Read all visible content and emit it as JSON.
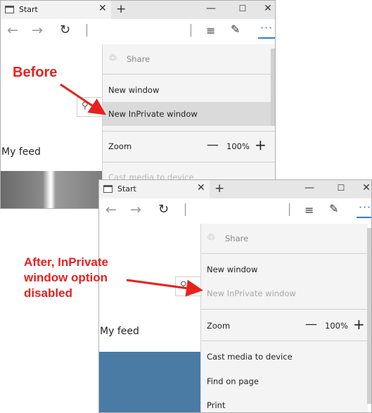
{
  "before_window": {
    "tab_title": "Start",
    "tab_close": "✕",
    "new_tab": "+",
    "minimize": "—",
    "maximize": "☐",
    "close": "✕",
    "page": {
      "feed_title": "My feed",
      "search_glyph": "⚲"
    },
    "menu": {
      "share": "Share",
      "new_window": "New window",
      "new_inprivate": "New InPrivate window",
      "zoom_label": "Zoom",
      "zoom_minus": "—",
      "zoom_value": "100%",
      "zoom_plus": "+",
      "cast": "Cast media to device"
    }
  },
  "after_window": {
    "tab_title": "Start",
    "tab_close": "✕",
    "new_tab": "+",
    "minimize": "—",
    "maximize": "☐",
    "close": "✕",
    "page": {
      "feed_title": "My feed",
      "search_glyph": "⚲"
    },
    "menu": {
      "share": "Share",
      "new_window": "New window",
      "new_inprivate": "New InPrivate window",
      "zoom_label": "Zoom",
      "zoom_minus": "—",
      "zoom_value": "100%",
      "zoom_plus": "+",
      "cast": "Cast media to device",
      "find": "Find on page",
      "print": "Print"
    }
  },
  "toolbar": {
    "back_icon": "←",
    "forward_icon": "→",
    "refresh_icon": "↻",
    "hub_icon": "≡",
    "note_icon": "✎",
    "more_icon": "···"
  },
  "annotations": {
    "before": "Before",
    "after": "After, InPrivate\nwindow option\ndisabled"
  },
  "colors": {
    "accent": "#2b7fd6",
    "annotation_red": "#e8211d",
    "menu_bg": "#f4f4f4",
    "menu_hover": "#dadada"
  }
}
